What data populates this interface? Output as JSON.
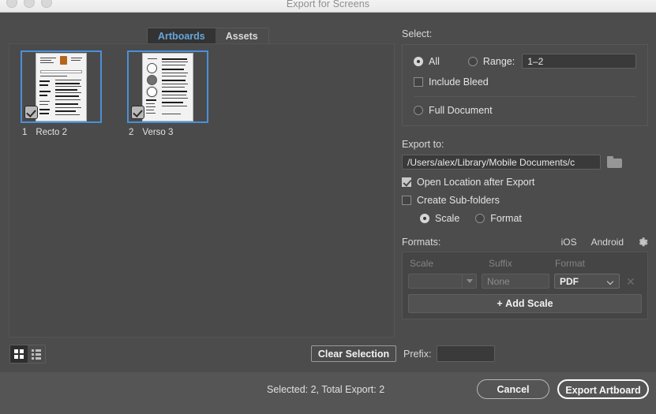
{
  "window": {
    "title": "Export for Screens",
    "traffic_lights": [
      "close-button",
      "minimize-button",
      "zoom-button"
    ]
  },
  "tabs": [
    {
      "label": "Artboards",
      "active": true
    },
    {
      "label": "Assets",
      "active": false
    }
  ],
  "artboards": [
    {
      "number": "1",
      "name": "Recto 2",
      "selected": true,
      "checked": true
    },
    {
      "number": "2",
      "name": "Verso 3",
      "selected": true,
      "checked": true
    }
  ],
  "select": {
    "section_label": "Select:",
    "all_label": "All",
    "all_selected": true,
    "range_label": "Range:",
    "range_selected": false,
    "range_value": "1–2",
    "include_bleed_label": "Include Bleed",
    "include_bleed_checked": false,
    "full_document_label": "Full Document",
    "full_document_selected": false
  },
  "export_to": {
    "section_label": "Export to:",
    "path": "/Users/alex/Library/Mobile Documents/c",
    "folder_icon": "folder-icon",
    "open_location_label": "Open Location after Export",
    "open_location_checked": true,
    "create_subfolders_label": "Create Sub-folders",
    "create_subfolders_checked": false,
    "scale_label": "Scale",
    "scale_selected": true,
    "format_label": "Format",
    "format_selected": false
  },
  "formats": {
    "section_label": "Formats:",
    "presets": [
      "iOS",
      "Android"
    ],
    "gear_icon": "gear-icon",
    "columns": [
      "Scale",
      "Suffix",
      "Format"
    ],
    "rows": [
      {
        "scale": "",
        "suffix_placeholder": "None",
        "format": "PDF",
        "remove_icon": "remove-x-icon"
      }
    ],
    "add_scale_label": "Add Scale",
    "add_scale_icon": "plus-icon"
  },
  "bottom_bar": {
    "grid_view_icon": "grid-view-icon",
    "list_view_icon": "list-view-icon",
    "grid_view_active": true,
    "clear_selection_label": "Clear Selection",
    "prefix_label": "Prefix:",
    "prefix_value": ""
  },
  "footer": {
    "status": "Selected: 2, Total Export: 2",
    "cancel_label": "Cancel",
    "export_label": "Export Artboard"
  },
  "colors": {
    "accent_blue": "#4a90d9",
    "tab_active_text": "#67a5d8",
    "window_bg": "#4c4c4c",
    "footer_bg": "#555555",
    "titlebar_bg": "#f3f3f3"
  }
}
